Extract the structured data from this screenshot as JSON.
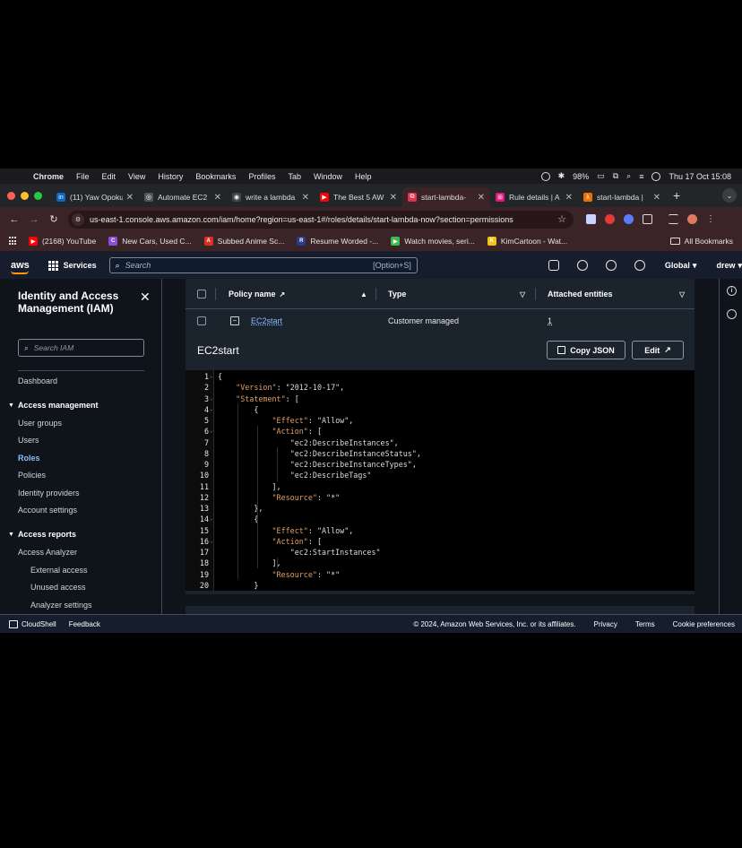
{
  "menubar": {
    "app": "Chrome",
    "items": [
      "File",
      "Edit",
      "View",
      "History",
      "Bookmarks",
      "Profiles",
      "Tab",
      "Window",
      "Help"
    ],
    "battery": "98%",
    "datetime": "Thu 17 Oct  15:08"
  },
  "tabs": [
    {
      "label": "(11) Yaw Opoku",
      "color": "#0a66c2",
      "glyph": "in"
    },
    {
      "label": "Automate EC2",
      "color": "#555555",
      "glyph": "◎"
    },
    {
      "label": "write a lambda",
      "color": "#444444",
      "glyph": "◉"
    },
    {
      "label": "The Best 5 AW",
      "color": "#ff0000",
      "glyph": "▶"
    },
    {
      "label": "start-lambda-",
      "color": "#dd344c",
      "glyph": "⧉",
      "active": true
    },
    {
      "label": "Rule details | A",
      "color": "#e7157b",
      "glyph": "⊞"
    },
    {
      "label": "start-lambda |",
      "color": "#ed7100",
      "glyph": "λ"
    }
  ],
  "address": {
    "url": "us-east-1.console.aws.amazon.com/iam/home?region=us-east-1#/roles/details/start-lambda-now?section=permissions"
  },
  "bookmarks": [
    {
      "label": "(2168) YouTube",
      "color": "#ff0000",
      "glyph": "▶"
    },
    {
      "label": "New Cars, Used C...",
      "color": "#8a4fd6",
      "glyph": "C"
    },
    {
      "label": "Subbed Anime Sc...",
      "color": "#d93025",
      "glyph": "A"
    },
    {
      "label": "Resume Worded -...",
      "color": "#2b3a8c",
      "glyph": "R"
    },
    {
      "label": "Watch movies, seri...",
      "color": "#3fb950",
      "glyph": "▶"
    },
    {
      "label": "KimCartoon - Wat...",
      "color": "#f2c318",
      "glyph": "K"
    }
  ],
  "all_bookmarks": "All Bookmarks",
  "aws_nav": {
    "logo": "aws",
    "services": "Services",
    "search_placeholder": "Search",
    "search_shortcut": "[Option+S]",
    "region": "Global",
    "user": "drew"
  },
  "sidebar": {
    "title": "Identity and Access Management (IAM)",
    "search_placeholder": "Search IAM",
    "dashboard": "Dashboard",
    "access_management": "Access management",
    "am_items": [
      "User groups",
      "Users",
      "Roles",
      "Policies",
      "Identity providers",
      "Account settings"
    ],
    "access_reports": "Access reports",
    "ar_items": [
      "Access Analyzer"
    ],
    "ar_sub_items": [
      "External access",
      "Unused access",
      "Analyzer settings"
    ]
  },
  "table": {
    "col_policy": "Policy name",
    "col_type": "Type",
    "col_attached": "Attached entities",
    "row": {
      "name": "EC2start",
      "type": "Customer managed",
      "attached": "1"
    }
  },
  "panel": {
    "title": "EC2start",
    "copy_json": "Copy JSON",
    "edit": "Edit"
  },
  "code_lines": [
    "{",
    "    \"Version\": \"2012-10-17\",",
    "    \"Statement\": [",
    "        {",
    "            \"Effect\": \"Allow\",",
    "            \"Action\": [",
    "                \"ec2:DescribeInstances\",",
    "                \"ec2:DescribeInstanceStatus\",",
    "                \"ec2:DescribeInstanceTypes\",",
    "                \"ec2:DescribeTags\"",
    "            ],",
    "            \"Resource\": \"*\"",
    "        },",
    "        {",
    "            \"Effect\": \"Allow\",",
    "            \"Action\": [",
    "                \"ec2:StartInstances\"",
    "            ],",
    "            \"Resource\": \"*\"",
    "        }"
  ],
  "footer": {
    "cloudshell": "CloudShell",
    "feedback": "Feedback",
    "copyright": "© 2024, Amazon Web Services, Inc. or its affiliates.",
    "privacy": "Privacy",
    "terms": "Terms",
    "cookies": "Cookie preferences"
  }
}
